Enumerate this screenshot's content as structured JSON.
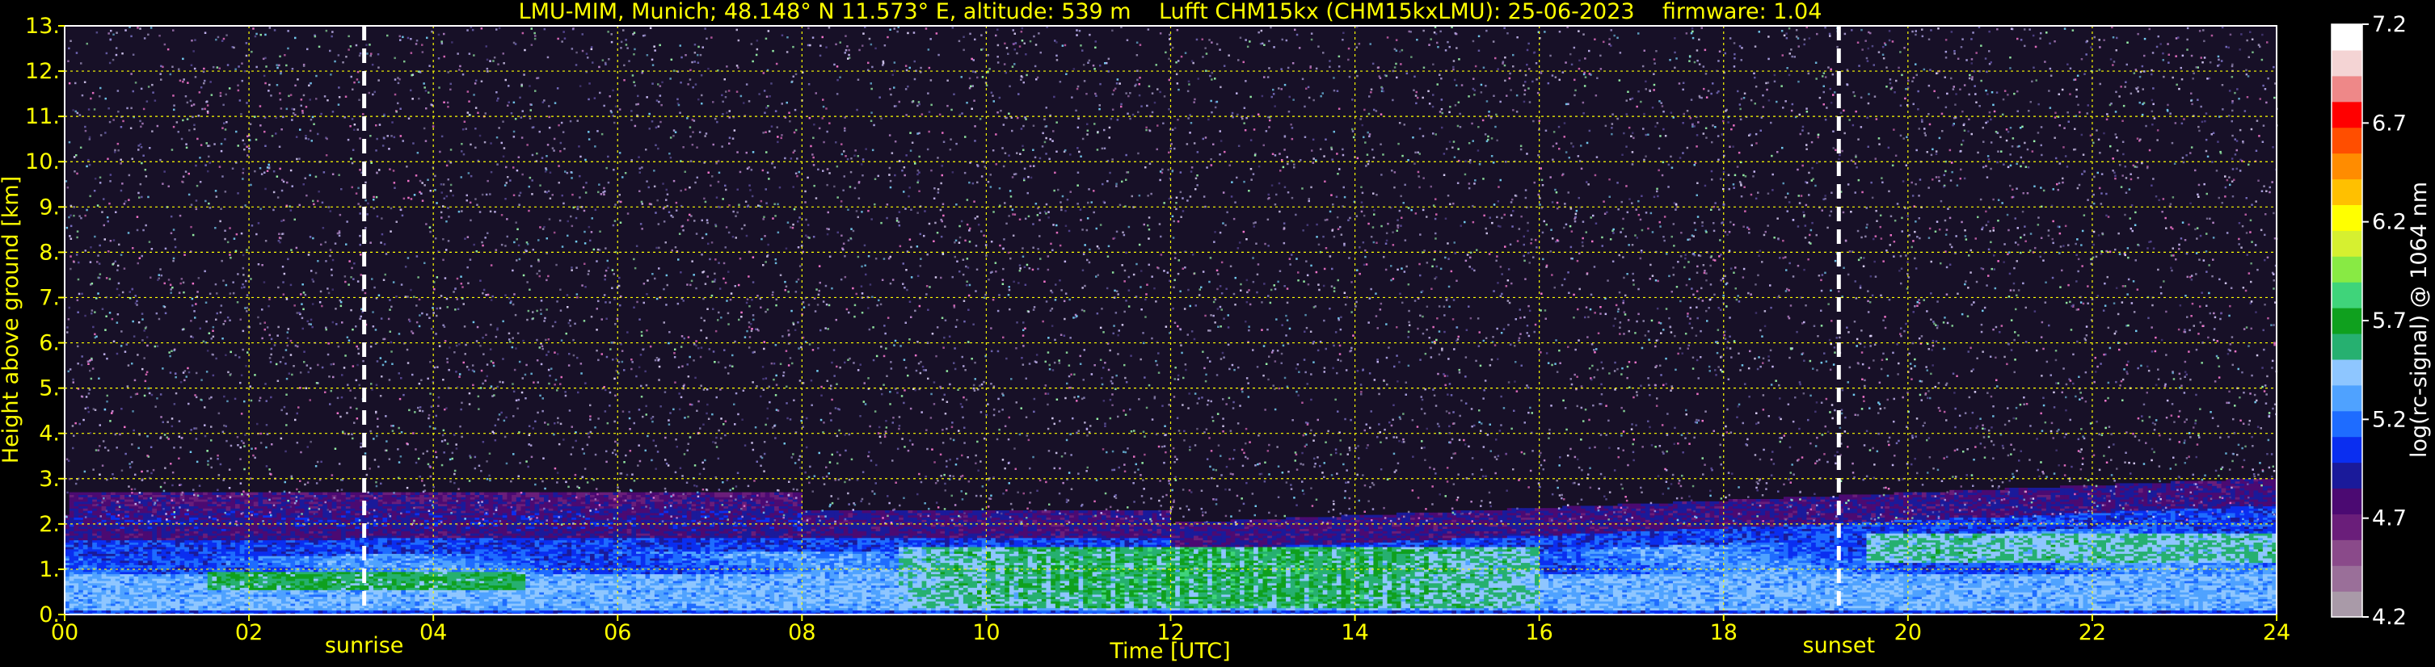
{
  "chart_data": {
    "type": "heatmap",
    "title": "LMU-MIM, Munich; 48.148° N 11.573° E, altitude: 539 m    Lufft CHM15kx (CHM15kxLMU): 25-06-2023    firmware: 1.04",
    "xlabel": "Time [UTC]",
    "ylabel": "Height above ground [km]",
    "colorbar_label": "log(rc-signal) @ 1064 nm",
    "xlim": [
      0,
      24
    ],
    "ylim": [
      0,
      13
    ],
    "x_ticks": [
      "00",
      "02",
      "04",
      "06",
      "08",
      "10",
      "12",
      "14",
      "16",
      "18",
      "20",
      "22",
      "24"
    ],
    "y_ticks": [
      "0.",
      "1.",
      "2.",
      "3.",
      "4.",
      "5.",
      "6.",
      "7.",
      "8.",
      "9.",
      "10.",
      "11.",
      "12.",
      "13."
    ],
    "colorbar_range": [
      4.2,
      7.2
    ],
    "colorbar_ticks": [
      "4.2",
      "4.7",
      "5.2",
      "5.7",
      "6.2",
      "6.7",
      "7.2"
    ],
    "grid": true,
    "grid_color": "#ffff00",
    "label_color": "#ffff00",
    "colormap": [
      "#a99aa8",
      "#9a6f99",
      "#8a4a8a",
      "#6a1e7a",
      "#4b0a72",
      "#1a1a9a",
      "#0a2ef0",
      "#1e6cff",
      "#4fa2ff",
      "#8ec6ff",
      "#26b070",
      "#0fa01e",
      "#3fd47a",
      "#88ea44",
      "#d6f030",
      "#ffff00",
      "#ffc000",
      "#ff8c00",
      "#ff4e00",
      "#ff0000",
      "#ee8888",
      "#f4d4d4",
      "#ffffff"
    ],
    "markers": [
      {
        "label": "sunrise",
        "x": 3.25
      },
      {
        "label": "sunset",
        "x": 19.25
      }
    ],
    "structures": {
      "surface_aerosol_layer": {
        "base_km": 0.0,
        "top_km": 0.9
      },
      "residual_layer": {
        "time_range": [
          0,
          8
        ],
        "height_range_km": [
          1.4,
          2.7
        ]
      },
      "mixed_layer_top_km": {
        "00": 1.6,
        "06": 1.7,
        "12": 1.4,
        "18": 1.9,
        "24": 2.4
      },
      "convective_plumes": {
        "time_range": [
          9,
          16
        ],
        "height_range_km": [
          0,
          1.5
        ]
      }
    }
  }
}
